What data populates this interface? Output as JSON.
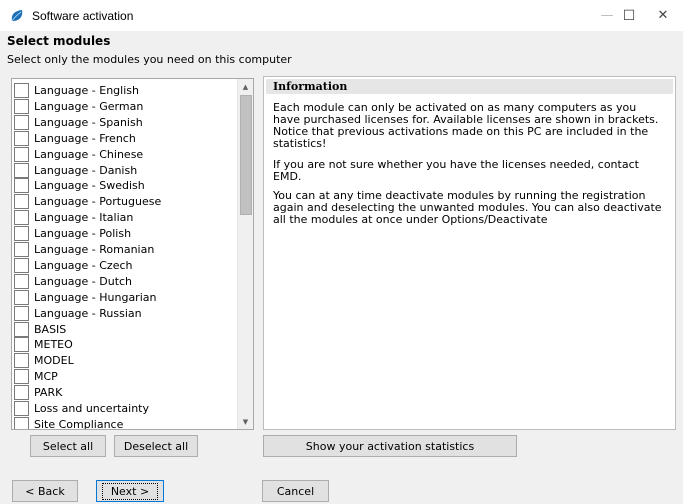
{
  "window": {
    "title": "Software activation",
    "minimize_glyph": "—",
    "maximize_glyph": "☐",
    "close_glyph": "✕"
  },
  "page": {
    "heading": "Select modules",
    "subheading": "Select only the modules you need on this computer"
  },
  "modules": [
    {
      "label": "Language - English",
      "checked": false
    },
    {
      "label": "Language - German",
      "checked": false
    },
    {
      "label": "Language - Spanish",
      "checked": false
    },
    {
      "label": "Language - French",
      "checked": false
    },
    {
      "label": "Language - Chinese",
      "checked": false
    },
    {
      "label": "Language - Danish",
      "checked": false
    },
    {
      "label": "Language - Swedish",
      "checked": false
    },
    {
      "label": "Language - Portuguese",
      "checked": false
    },
    {
      "label": "Language - Italian",
      "checked": false
    },
    {
      "label": "Language - Polish",
      "checked": false
    },
    {
      "label": "Language - Romanian",
      "checked": false
    },
    {
      "label": "Language - Czech",
      "checked": false
    },
    {
      "label": "Language - Dutch",
      "checked": false
    },
    {
      "label": "Language - Hungarian",
      "checked": false
    },
    {
      "label": "Language - Russian",
      "checked": false
    },
    {
      "label": "BASIS",
      "checked": false
    },
    {
      "label": "METEO",
      "checked": false
    },
    {
      "label": "MODEL",
      "checked": false
    },
    {
      "label": "MCP",
      "checked": false
    },
    {
      "label": "PARK",
      "checked": false
    },
    {
      "label": "Loss and uncertainty",
      "checked": false
    },
    {
      "label": "Site Compliance",
      "checked": false
    }
  ],
  "info": {
    "title": "Information",
    "paragraph1": "Each module can only be activated on as many computers as you have purchased licenses for.  Available licenses are shown in brackets. Notice that previous activations made on this PC are included in the statistics!",
    "paragraph2": "If you are not sure whether you have the licenses needed, contact EMD.",
    "paragraph3": "You can at any time deactivate modules by running the registration again and deselecting the unwanted modules. You can also deactivate all the modules at once under Options/Deactivate"
  },
  "buttons": {
    "select_all": "Select all",
    "deselect_all": "Deselect all",
    "show_statistics": "Show your activation statistics",
    "back": "< Back",
    "next": "Next >",
    "cancel": "Cancel"
  },
  "colors": {
    "icon_fill": "#1b6fb8",
    "default_button_border": "#0078d7"
  }
}
